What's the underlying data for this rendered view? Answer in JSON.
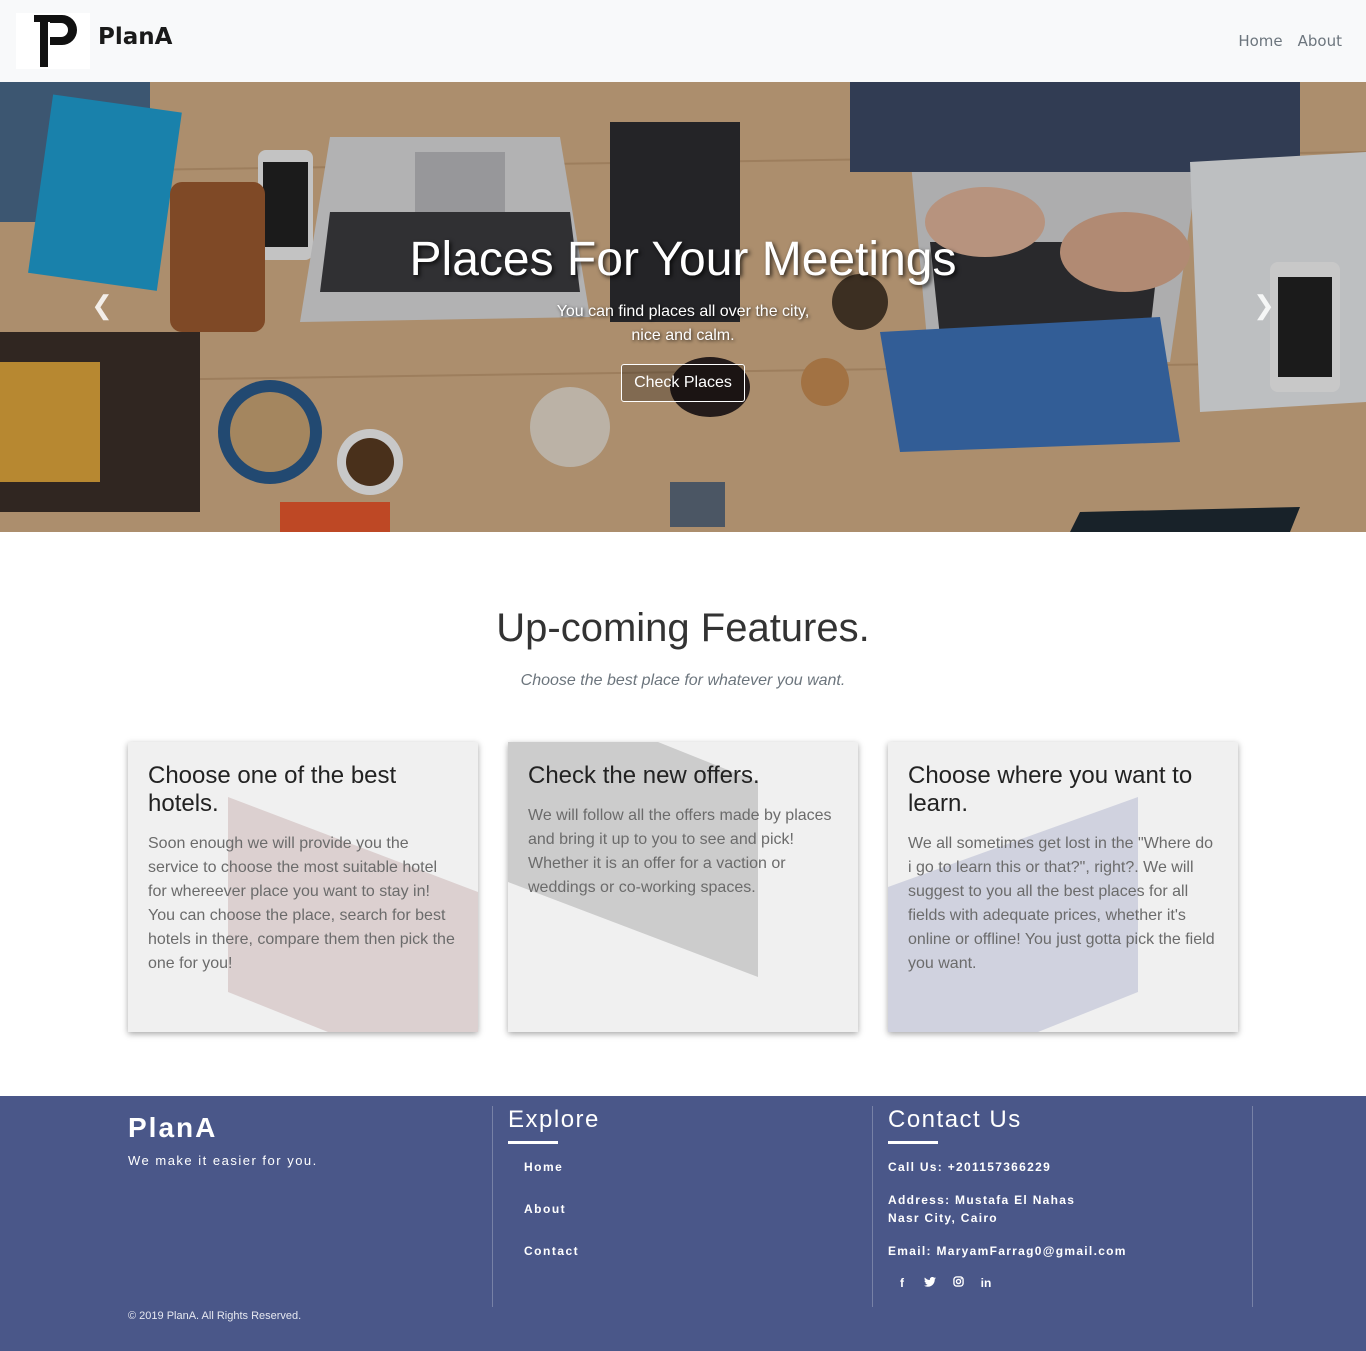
{
  "navbar": {
    "brand": "PlanA",
    "links": [
      "Home",
      "About"
    ]
  },
  "hero": {
    "title": "Places For Your Meetings",
    "subtitle_line1": "You can find places all over the city,",
    "subtitle_line2": "nice and calm.",
    "button": "Check Places",
    "prev_icon": "chevron-left-icon",
    "next_icon": "chevron-right-icon"
  },
  "features": {
    "title": "Up-coming Features.",
    "subtitle": "Choose the best place for whatever you want.",
    "cards": [
      {
        "title": "Choose one of the best hotels.",
        "text": "Soon enough we will provide you the service to choose the most suitable hotel for whereever place you want to stay in! You can choose the place, search for best hotels in there, compare them then pick the one for you!",
        "accent": "#dcd0d0"
      },
      {
        "title": "Check the new offers.",
        "text": "We will follow all the offers made by places and bring it up to you to see and pick! Whether it is an offer for a vaction or weddings or co-working spaces.",
        "accent": "#cccccc"
      },
      {
        "title": "Choose where you want to learn.",
        "text": "We all sometimes get lost in the \"Where do i go to learn this or that?\", right?. We will suggest to you all the best places for all fields with adequate prices, whether it's online or offline! You just gotta pick the field you want.",
        "accent": "#d0d2df"
      }
    ]
  },
  "footer": {
    "brand": "PlanA",
    "tagline": "We make it easier for you.",
    "explore": {
      "heading": "Explore",
      "links": [
        "Home",
        "About",
        "Contact"
      ]
    },
    "contact": {
      "heading": "Contact Us",
      "phone": "Call Us: +201157366229",
      "address_line1": "Address: Mustafa El Nahas",
      "address_line2": "Nasr City, Cairo",
      "email": "Email: MaryamFarrag0@gmail.com",
      "socials": [
        "f",
        "twitter",
        "instagram",
        "in"
      ]
    },
    "copyright": "© 2019 PlanA. All Rights Reserved.",
    "bg_color": "#4a5789"
  }
}
